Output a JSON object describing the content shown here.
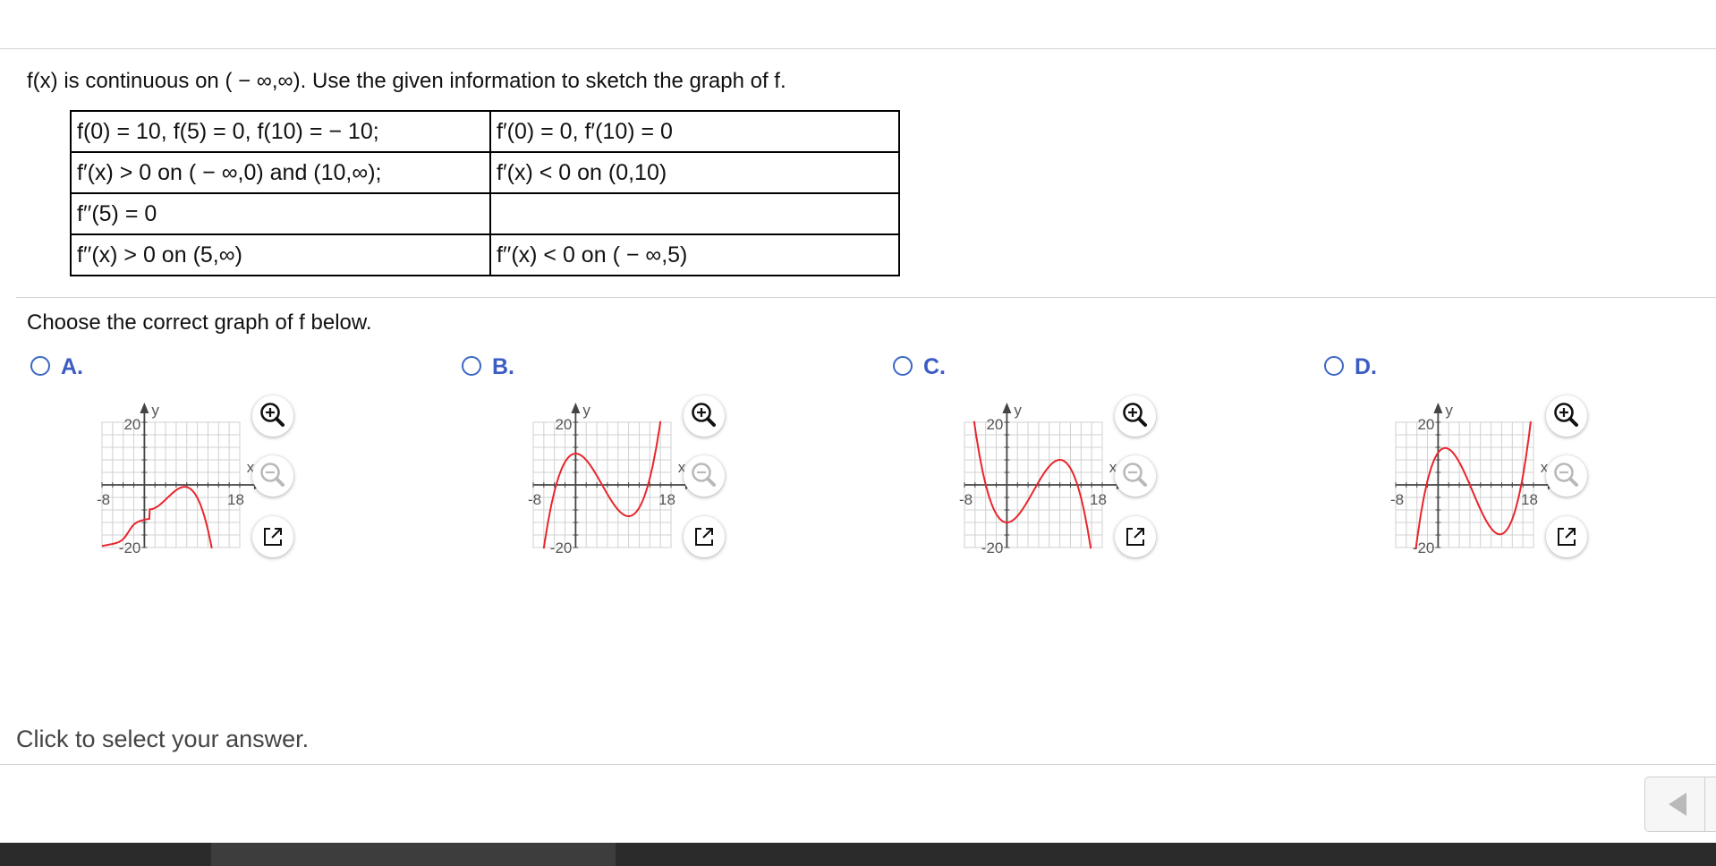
{
  "question": {
    "text": "f(x) is continuous on ( − ∞,∞). Use the given information to sketch the graph of f."
  },
  "info_table": {
    "rows": [
      [
        "f(0) = 10, f(5) = 0, f(10) =  − 10;",
        "f′(0) = 0, f′(10) = 0"
      ],
      [
        "f′(x) > 0 on ( − ∞,0) and (10,∞);",
        "f′(x) < 0 on (0,10)"
      ],
      [
        "f′′(5) = 0",
        ""
      ],
      [
        "f′′(x) > 0 on (5,∞)",
        "f′′(x) < 0 on ( − ∞,5)"
      ]
    ]
  },
  "prompt": {
    "text": "Choose the correct graph of f below."
  },
  "options": [
    {
      "letter": "A.",
      "selected": false
    },
    {
      "letter": "B.",
      "selected": false
    },
    {
      "letter": "C.",
      "selected": false
    },
    {
      "letter": "D.",
      "selected": false
    }
  ],
  "graph_labels": {
    "y_axis": "y",
    "x_axis": "x",
    "y_max": "20",
    "y_min": "-20",
    "x_min": "-8",
    "x_max": "18"
  },
  "icons": {
    "zoom_in": "zoom-in-icon",
    "zoom_out": "zoom-out-icon",
    "popout": "popout-icon",
    "nav_prev": "triangle-left-icon"
  },
  "colors": {
    "curve": "#e8262c",
    "radio": "#3b67c4",
    "letter": "#3b5cc4",
    "grid": "#d0d0d0"
  },
  "footer": {
    "text": "Click to select your answer."
  }
}
